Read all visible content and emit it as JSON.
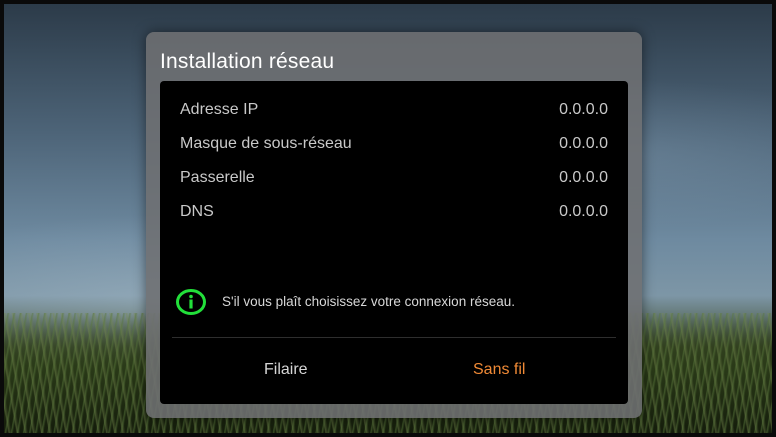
{
  "dialog": {
    "title": "Installation réseau",
    "fields": [
      {
        "label": "Adresse IP",
        "value": "0.0.0.0"
      },
      {
        "label": "Masque de sous-réseau",
        "value": "0.0.0.0"
      },
      {
        "label": "Passerelle",
        "value": "0.0.0.0"
      },
      {
        "label": "DNS",
        "value": "0.0.0.0"
      }
    ],
    "message": {
      "icon": "info-icon",
      "text": "S'il vous plaît choisissez votre connexion réseau."
    },
    "options": {
      "wired_label": "Filaire",
      "wireless_label": "Sans fil",
      "selected": "Sans fil"
    },
    "colors": {
      "selected_option": "#f08a36",
      "info_icon": "#22e03a"
    }
  }
}
